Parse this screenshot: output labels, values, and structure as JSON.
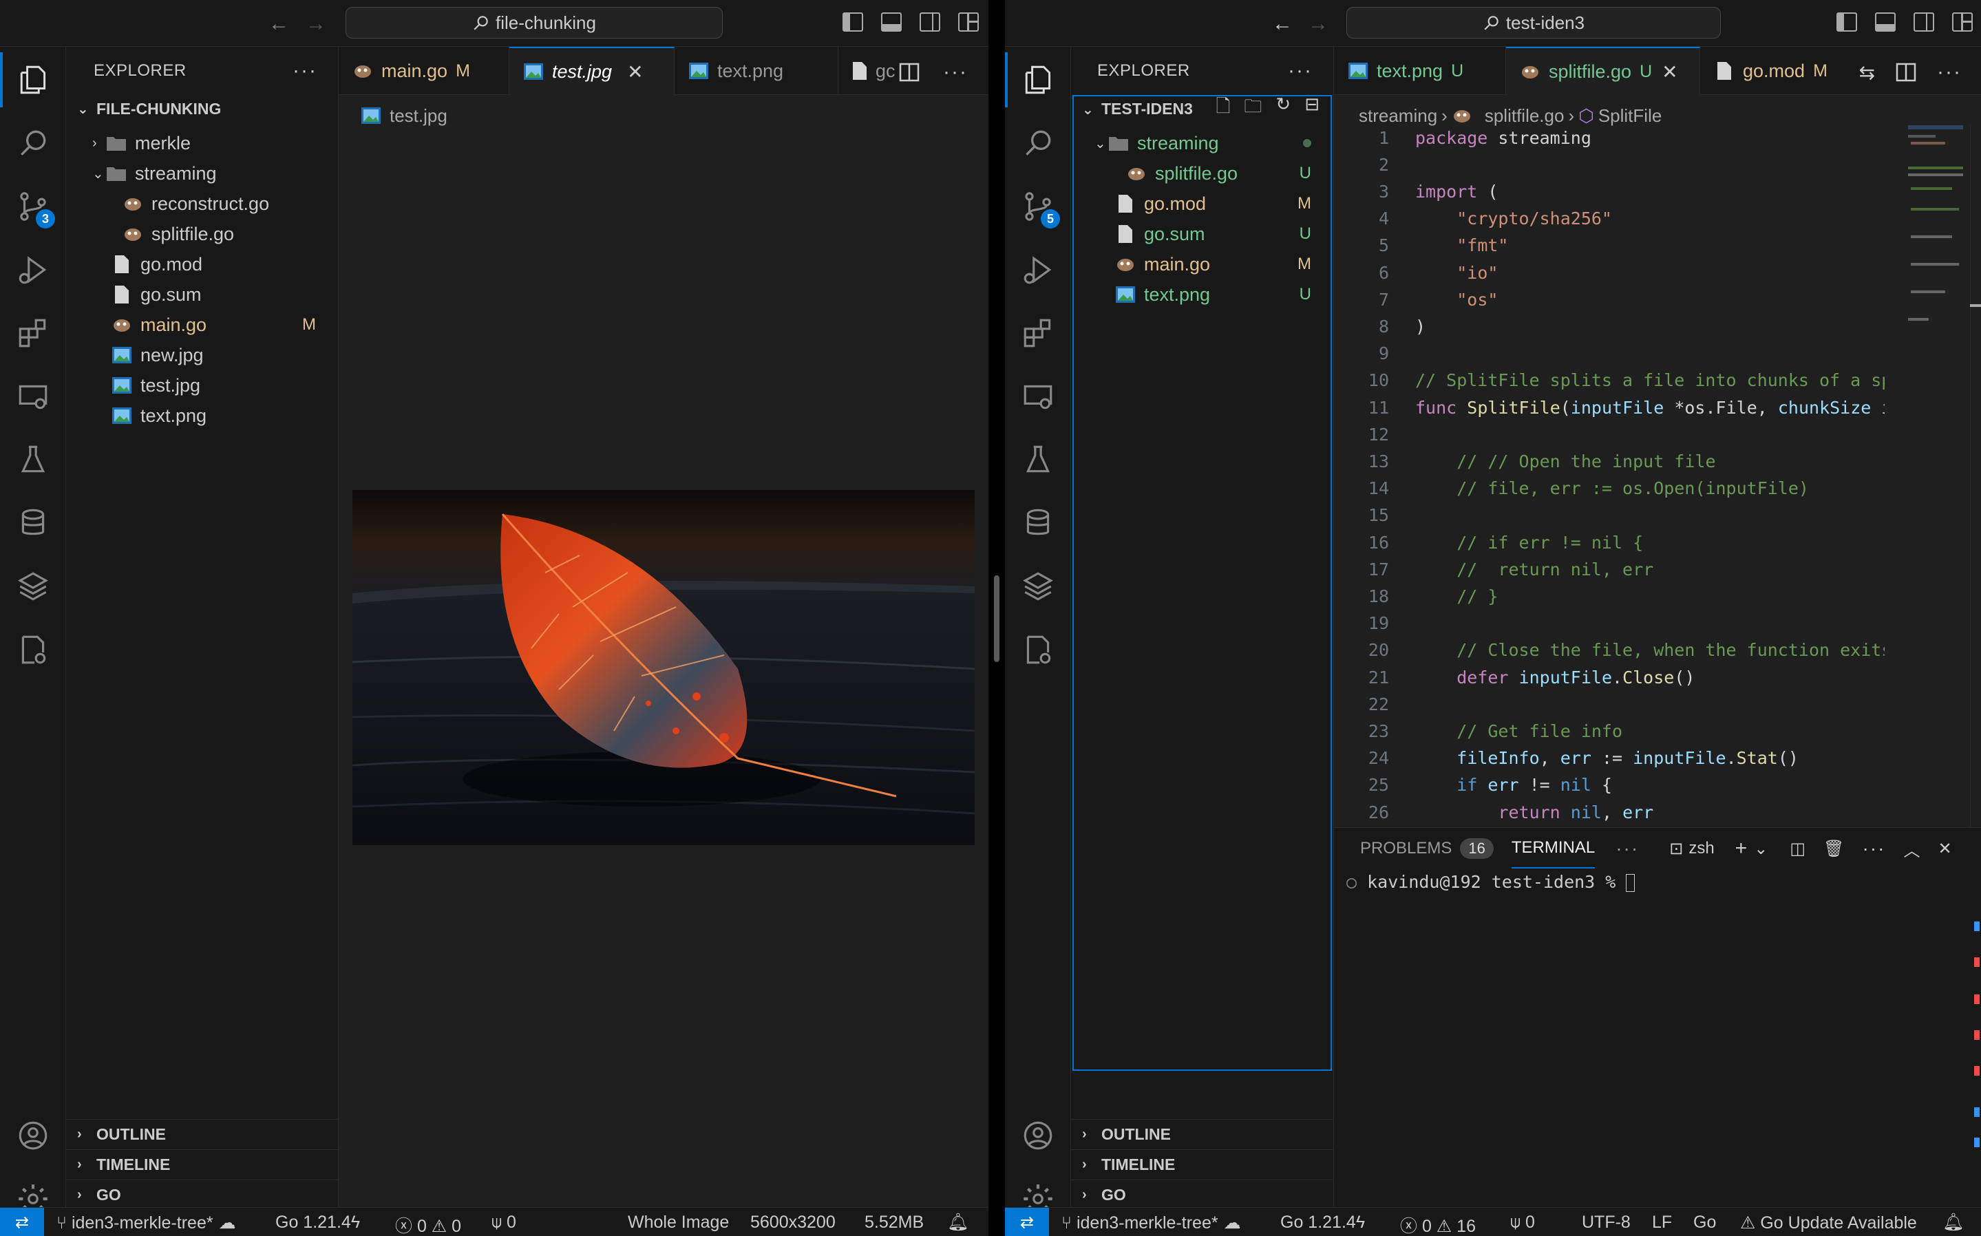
{
  "left": {
    "search_title": "file-chunking",
    "explorer_title": "EXPLORER",
    "folder": "FILE-CHUNKING",
    "scm_badge": "3",
    "tree": [
      {
        "label": "merkle",
        "kind": "folder",
        "state": "collapsed"
      },
      {
        "label": "streaming",
        "kind": "folder",
        "state": "expanded"
      },
      {
        "label": "reconstruct.go",
        "kind": "go"
      },
      {
        "label": "splitfile.go",
        "kind": "go"
      },
      {
        "label": "go.mod",
        "kind": "file"
      },
      {
        "label": "go.sum",
        "kind": "file"
      },
      {
        "label": "main.go",
        "kind": "go",
        "status": "M"
      },
      {
        "label": "new.jpg",
        "kind": "image"
      },
      {
        "label": "test.jpg",
        "kind": "image"
      },
      {
        "label": "text.png",
        "kind": "image"
      }
    ],
    "tabs": [
      {
        "label": "main.go",
        "status": "M"
      },
      {
        "label": "test.jpg",
        "active": true
      },
      {
        "label": "text.png"
      },
      {
        "label": "gc"
      }
    ],
    "breadcrumb": "test.jpg",
    "sections": [
      "OUTLINE",
      "TIMELINE",
      "GO"
    ],
    "status": {
      "branch": "iden3-merkle-tree*",
      "go_version": "Go 1.21.4",
      "errors": "0",
      "warnings": "0",
      "ports": "0",
      "image_mode": "Whole Image",
      "dimensions": "5600x3200",
      "size": "5.52MB"
    }
  },
  "right": {
    "search_title": "test-iden3",
    "explorer_title": "EXPLORER",
    "folder": "TEST-IDEN3",
    "scm_badge": "5",
    "tree": [
      {
        "label": "streaming",
        "kind": "folder",
        "state": "expanded",
        "color": "#73c991"
      },
      {
        "label": "splitfile.go",
        "kind": "go",
        "status": "U"
      },
      {
        "label": "go.mod",
        "kind": "file",
        "status": "M"
      },
      {
        "label": "go.sum",
        "kind": "file",
        "status": "U"
      },
      {
        "label": "main.go",
        "kind": "go",
        "status": "M"
      },
      {
        "label": "text.png",
        "kind": "image",
        "status": "U"
      }
    ],
    "tabs": [
      {
        "label": "text.png",
        "status": "U"
      },
      {
        "label": "splitfile.go",
        "status": "U",
        "active": true
      },
      {
        "label": "go.mod",
        "status": "M"
      }
    ],
    "breadcrumb": [
      "streaming",
      "splitfile.go",
      "SplitFile"
    ],
    "code": [
      "package streaming",
      "",
      "import (",
      "    \"crypto/sha256\"",
      "    \"fmt\"",
      "    \"io\"",
      "    \"os\"",
      ")",
      "",
      "// SplitFile splits a file into chunks of a spe",
      "func SplitFile(inputFile *os.File, chunkSize in",
      "",
      "    // // Open the input file",
      "    // file, err := os.Open(inputFile)",
      "",
      "    // if err != nil {",
      "    //  return nil, err",
      "    // }",
      "",
      "    // Close the file, when the function exits",
      "    defer inputFile.Close()",
      "",
      "    // Get file info",
      "    fileInfo, err := inputFile.Stat()",
      "    if err != nil {",
      "        return nil, err",
      "    }",
      ""
    ],
    "panel": {
      "problems_label": "PROBLEMS",
      "problems_count": "16",
      "terminal_label": "TERMINAL",
      "shell": "zsh",
      "prompt": "kavindu@192 test-iden3 % "
    },
    "sections": [
      "OUTLINE",
      "TIMELINE",
      "GO"
    ],
    "status": {
      "branch": "iden3-merkle-tree*",
      "go_version": "Go 1.21.4",
      "errors": "0",
      "warnings": "16",
      "ports": "0",
      "encoding": "UTF-8",
      "eol": "LF",
      "language": "Go",
      "update": "Go Update Available"
    }
  }
}
